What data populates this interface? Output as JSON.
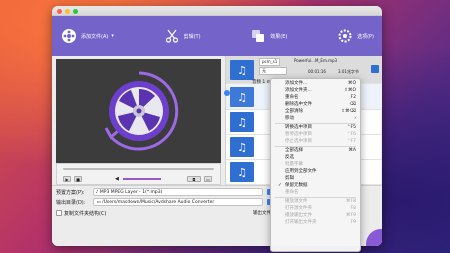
{
  "app": {
    "colors": {
      "toolbar": "#7464c9",
      "accent": "#8a5ad6",
      "brand_icon": "#7b4fd0"
    }
  },
  "toolbar": {
    "add_files_label": "添加文件(A)",
    "trim_label": "剪辑(T)",
    "edit_label": "效果(E)",
    "preferences_label": "选项(P)"
  },
  "file_list": {
    "rows": [
      {
        "title": "Powerful...M_Em.mp3",
        "format_chip": "pcm_s1",
        "lang_chip": "无",
        "duration": "00:01:16",
        "size": "3.01兆字节"
      },
      {
        "title": "",
        "subtitle_text": "无"
      },
      {
        "title": ""
      },
      {
        "title": ""
      },
      {
        "title": ""
      }
    ],
    "subtitle_label": "音频 1 mp3"
  },
  "bottom": {
    "profile_label": "预置方案(P):",
    "profile_value": "MP3 MPEG Layer - 1(*.mp3)",
    "output_label": "输出目录(D):",
    "output_value": "/Users/macdown/Music/Avdshare Audio Converter",
    "copy_folder_label": "复制文件夹结构(C)",
    "output_file_label": "输出文件"
  },
  "context_menu": {
    "items": [
      {
        "label": "添加文件...",
        "shortcut": "⌘O",
        "disabled": false
      },
      {
        "label": "添加文件夹...",
        "shortcut": "⇧⌘O",
        "disabled": false
      },
      {
        "label": "重命名",
        "shortcut": "F2",
        "disabled": false
      },
      {
        "label": "删除选中文件",
        "shortcut": "⌫",
        "disabled": false
      },
      {
        "label": "全部清除",
        "shortcut": "⇧⌘⌫",
        "disabled": false
      },
      {
        "label": "移动",
        "shortcut": "›",
        "disabled": false
      },
      {
        "sep": true
      },
      {
        "label": "转换选中项目",
        "shortcut": "⌃F5",
        "disabled": false
      },
      {
        "label": "暂停选中项目",
        "shortcut": "⌃F6",
        "disabled": true
      },
      {
        "label": "停止选中项目",
        "shortcut": "⌃F7",
        "disabled": true
      },
      {
        "sep": true
      },
      {
        "label": "全部选择",
        "shortcut": "⌘A",
        "disabled": false
      },
      {
        "label": "反选",
        "shortcut": "",
        "disabled": false
      },
      {
        "label": "批量字幕",
        "shortcut": "",
        "disabled": true
      },
      {
        "label": "应用到全部文件",
        "shortcut": "",
        "disabled": false
      },
      {
        "label": "剪辑",
        "shortcut": "",
        "disabled": false
      },
      {
        "label": "保留元数据",
        "shortcut": "",
        "disabled": false,
        "checked": true
      },
      {
        "label": "重命名",
        "shortcut": "",
        "disabled": true
      },
      {
        "sep": true
      },
      {
        "label": "播放源文件",
        "shortcut": "⌘F8",
        "disabled": true
      },
      {
        "label": "打开源文件夹",
        "shortcut": "F8",
        "disabled": true
      },
      {
        "label": "播放输出文件",
        "shortcut": "⌘F9",
        "disabled": true
      },
      {
        "label": "打开输出文件夹",
        "shortcut": "F9",
        "disabled": true
      }
    ]
  }
}
